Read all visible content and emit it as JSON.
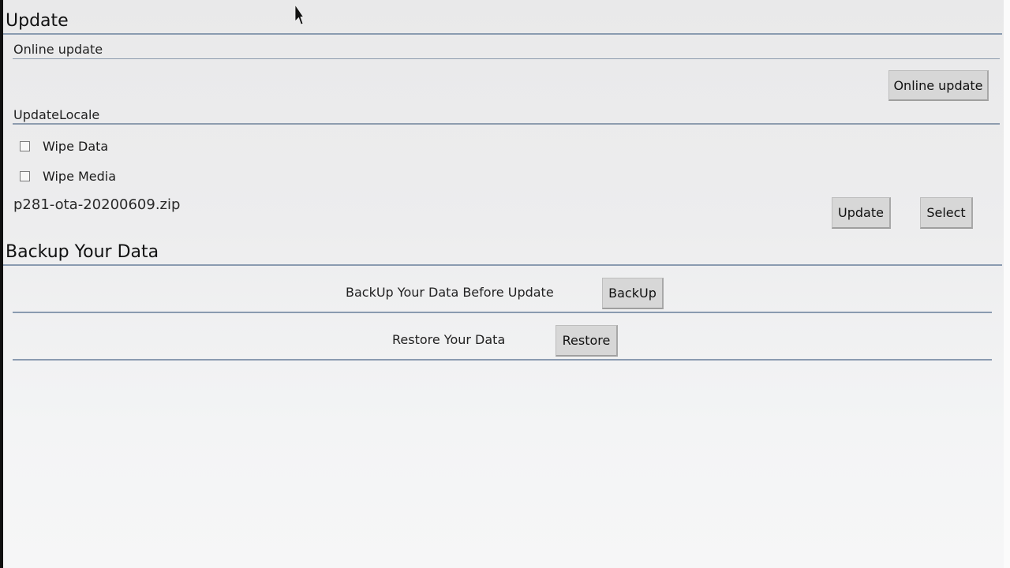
{
  "update_section": {
    "title": "Update",
    "online_update": {
      "title": "Online update",
      "button_label": "Online update"
    },
    "update_locale": {
      "title": "UpdateLocale",
      "wipe_data_label": "Wipe Data",
      "wipe_data_checked": false,
      "wipe_media_label": "Wipe Media",
      "wipe_media_checked": false,
      "selected_file": "p281-ota-20200609.zip",
      "update_button_label": "Update",
      "select_button_label": "Select"
    }
  },
  "backup_section": {
    "title": "Backup Your Data",
    "backup_row": {
      "label": "BackUp Your Data Before Update",
      "button_label": "BackUp"
    },
    "restore_row": {
      "label": "Restore Your Data",
      "button_label": "Restore"
    }
  },
  "colors": {
    "divider": "#8a9bb0",
    "button_bg": "#d7d7d7",
    "background": "#ececed"
  }
}
